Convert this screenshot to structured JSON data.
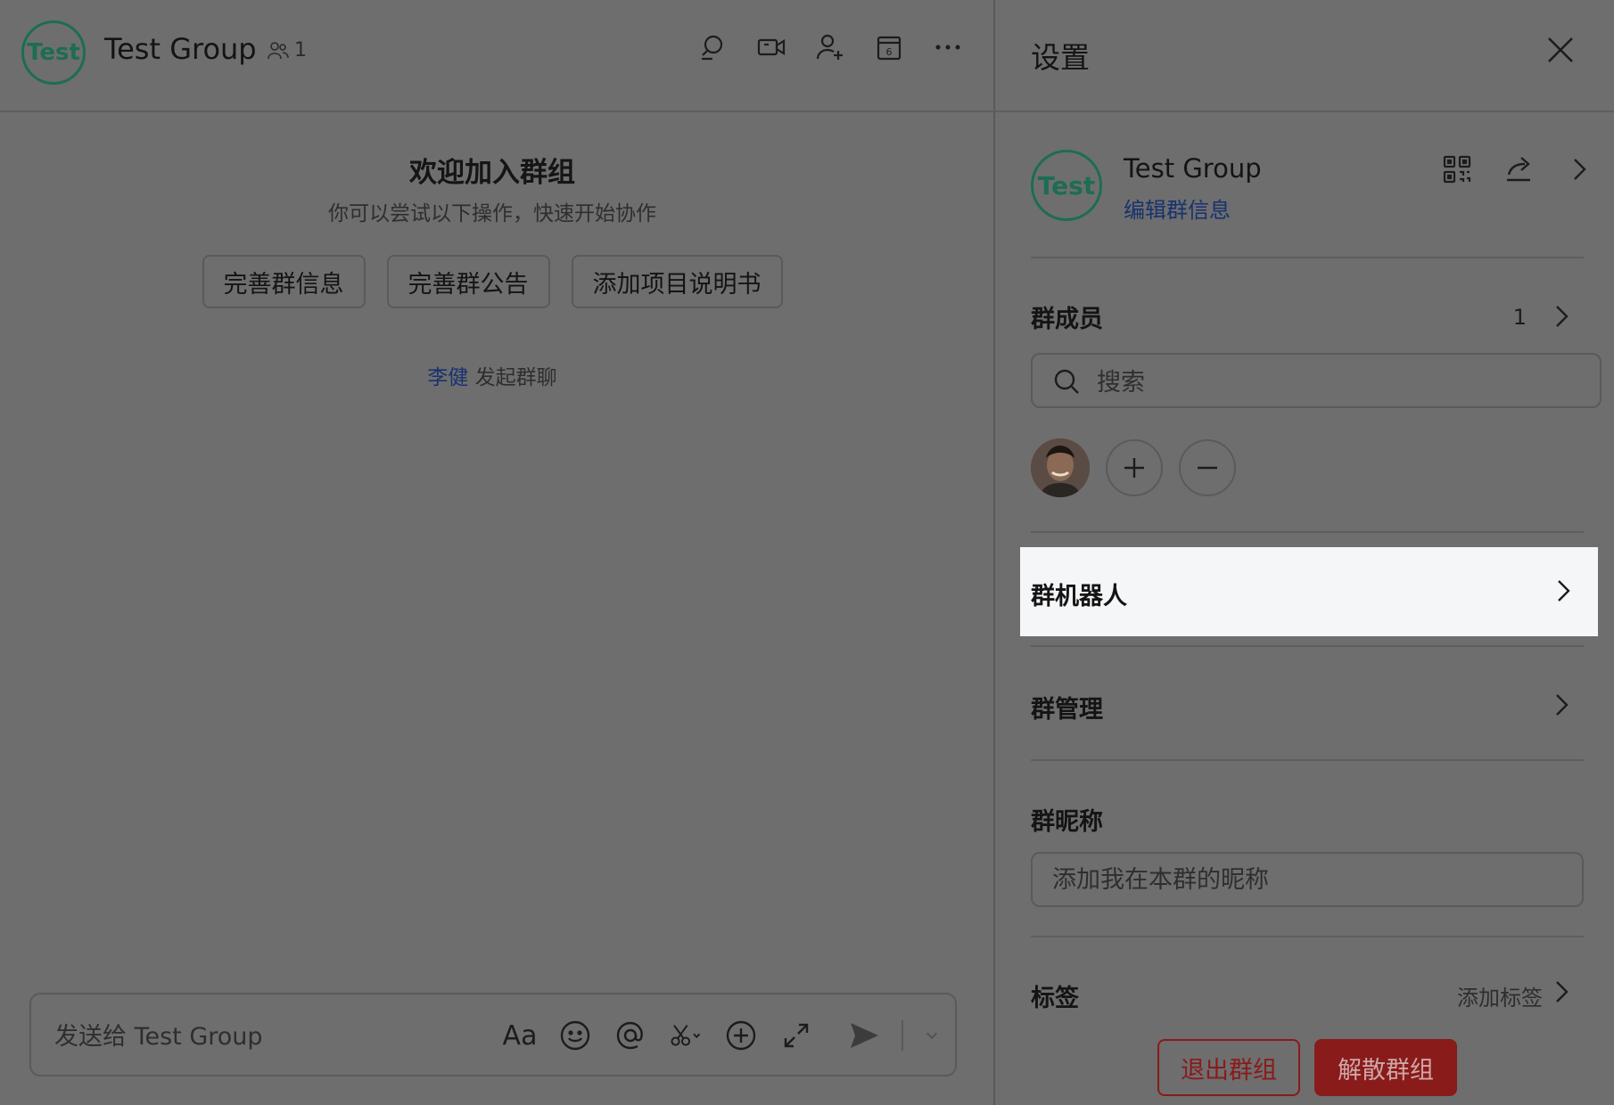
{
  "chat": {
    "avatar_text": "Test",
    "title": "Test Group",
    "member_count": "1",
    "header_icons": [
      "search-icon",
      "video-call-icon",
      "add-member-icon",
      "calendar-icon",
      "more-icon"
    ],
    "calendar_day": "6",
    "welcome_title": "欢迎加入群组",
    "welcome_subtitle": "你可以尝试以下操作，快速开始协作",
    "quick_actions": [
      "完善群信息",
      "完善群公告",
      "添加项目说明书"
    ],
    "system_message": {
      "user": "李健",
      "action": "发起群聊"
    },
    "composer": {
      "placeholder": "发送给 Test Group",
      "font_tool": "Aa"
    }
  },
  "settings": {
    "title": "设置",
    "group": {
      "avatar_text": "Test",
      "name": "Test Group",
      "edit_link": "编辑群信息"
    },
    "members": {
      "label": "群成员",
      "count": "1",
      "search_placeholder": "搜索"
    },
    "bots": {
      "label": "群机器人"
    },
    "management": {
      "label": "群管理"
    },
    "nickname": {
      "label": "群昵称",
      "placeholder": "添加我在本群的昵称"
    },
    "tags": {
      "label": "标签",
      "add_label": "添加标签"
    },
    "leave_button": "退出群组",
    "dissolve_button": "解散群组"
  },
  "colors": {
    "overlay": "#6e6e6e",
    "brand_green": "#1c6d54",
    "link_blue": "#17326e",
    "danger": "#8a1b1b",
    "highlight_row": "#f5f6f8"
  }
}
